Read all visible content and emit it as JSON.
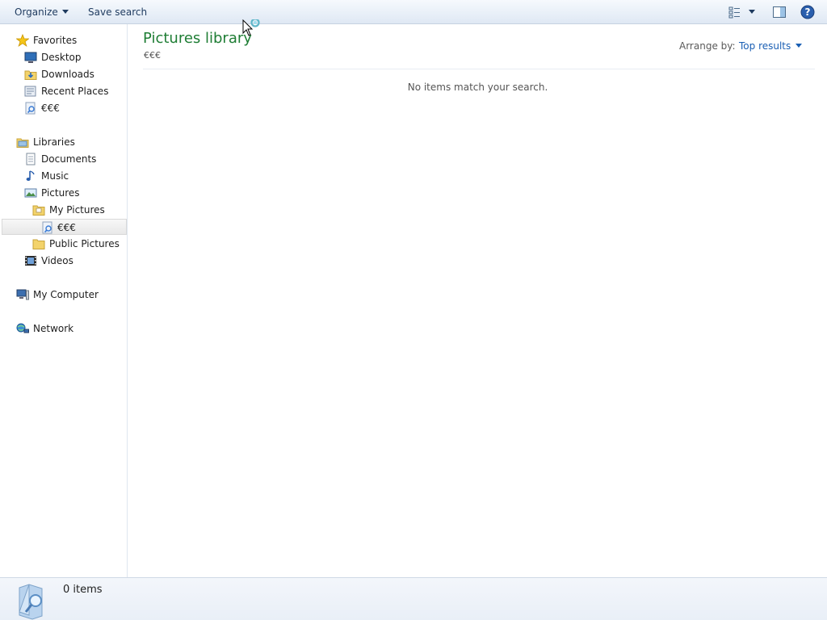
{
  "toolbar": {
    "organize_label": "Organize",
    "save_search_label": "Save search"
  },
  "nav": {
    "favorites": {
      "label": "Favorites",
      "items": [
        {
          "label": "Desktop",
          "icon": "desktop-icon"
        },
        {
          "label": "Downloads",
          "icon": "downloads-folder-icon"
        },
        {
          "label": "Recent Places",
          "icon": "recent-places-icon"
        },
        {
          "label": "€€€",
          "icon": "saved-search-icon"
        }
      ]
    },
    "libraries": {
      "label": "Libraries",
      "items": [
        {
          "label": "Documents",
          "icon": "documents-icon"
        },
        {
          "label": "Music",
          "icon": "music-icon"
        },
        {
          "label": "Pictures",
          "icon": "pictures-icon"
        },
        {
          "label": "My Pictures",
          "icon": "folder-icon"
        },
        {
          "label": "€€€",
          "icon": "saved-search-icon",
          "selected": true
        },
        {
          "label": "Public Pictures",
          "icon": "folder-icon"
        },
        {
          "label": "Videos",
          "icon": "videos-icon"
        }
      ]
    },
    "computer": {
      "label": "My Computer",
      "icon": "computer-icon"
    },
    "network": {
      "label": "Network",
      "icon": "network-icon"
    }
  },
  "content": {
    "title": "Pictures library",
    "subtitle": "€€€",
    "arrange_label": "Arrange by:",
    "arrange_value": "Top results",
    "empty_message": "No items match your search."
  },
  "details": {
    "item_count": "0 items"
  },
  "colors": {
    "title_green": "#1e7d34",
    "link_blue": "#1a5fb4",
    "toolbar_bg": "#e9f0f8"
  }
}
